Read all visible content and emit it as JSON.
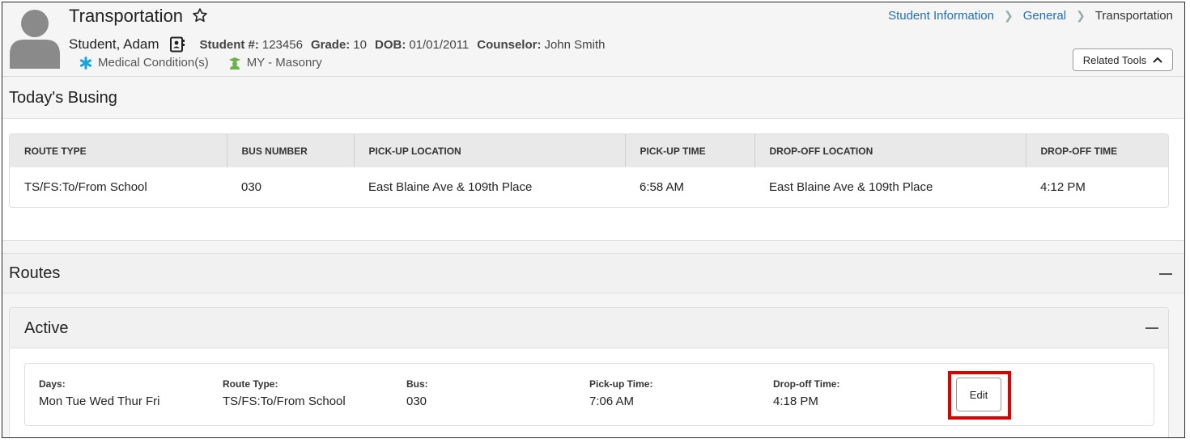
{
  "header": {
    "title": "Transportation",
    "student_name": "Student, Adam",
    "student_num_label": "Student #:",
    "student_num": "123456",
    "grade_label": "Grade:",
    "grade": "10",
    "dob_label": "DOB:",
    "dob": "01/01/2011",
    "counselor_label": "Counselor:",
    "counselor": "John Smith",
    "flags": [
      {
        "label": "Medical Condition(s)",
        "icon": "asterisk-icon",
        "color": "#1aa3e0"
      },
      {
        "label": "MY - Masonry",
        "icon": "graduate-icon",
        "color": "#6ab04c"
      }
    ]
  },
  "breadcrumb": {
    "items": [
      "Student Information",
      "General"
    ],
    "current": "Transportation"
  },
  "related_tools": {
    "label": "Related Tools"
  },
  "todays_busing": {
    "title": "Today's Busing",
    "columns": [
      "ROUTE TYPE",
      "BUS NUMBER",
      "PICK-UP LOCATION",
      "PICK-UP TIME",
      "DROP-OFF LOCATION",
      "DROP-OFF TIME"
    ],
    "rows": [
      [
        "TS/FS:To/From School",
        "030",
        "East Blaine Ave & 109th Place",
        "6:58 AM",
        "East Blaine Ave & 109th Place",
        "4:12 PM"
      ]
    ]
  },
  "routes": {
    "title": "Routes",
    "active": {
      "title": "Active",
      "days_label": "Days:",
      "days": "Mon Tue Wed Thur Fri",
      "route_type_label": "Route Type:",
      "route_type": "TS/FS:To/From School",
      "bus_label": "Bus:",
      "bus": "030",
      "pickup_label": "Pick-up Time:",
      "pickup": "7:06 AM",
      "dropoff_label": "Drop-off Time:",
      "dropoff": "4:18 PM",
      "edit_label": "Edit"
    }
  },
  "colors": {
    "link": "#1f6fb5",
    "highlight": "#e00000",
    "header_bg": "#f5f5f5"
  }
}
